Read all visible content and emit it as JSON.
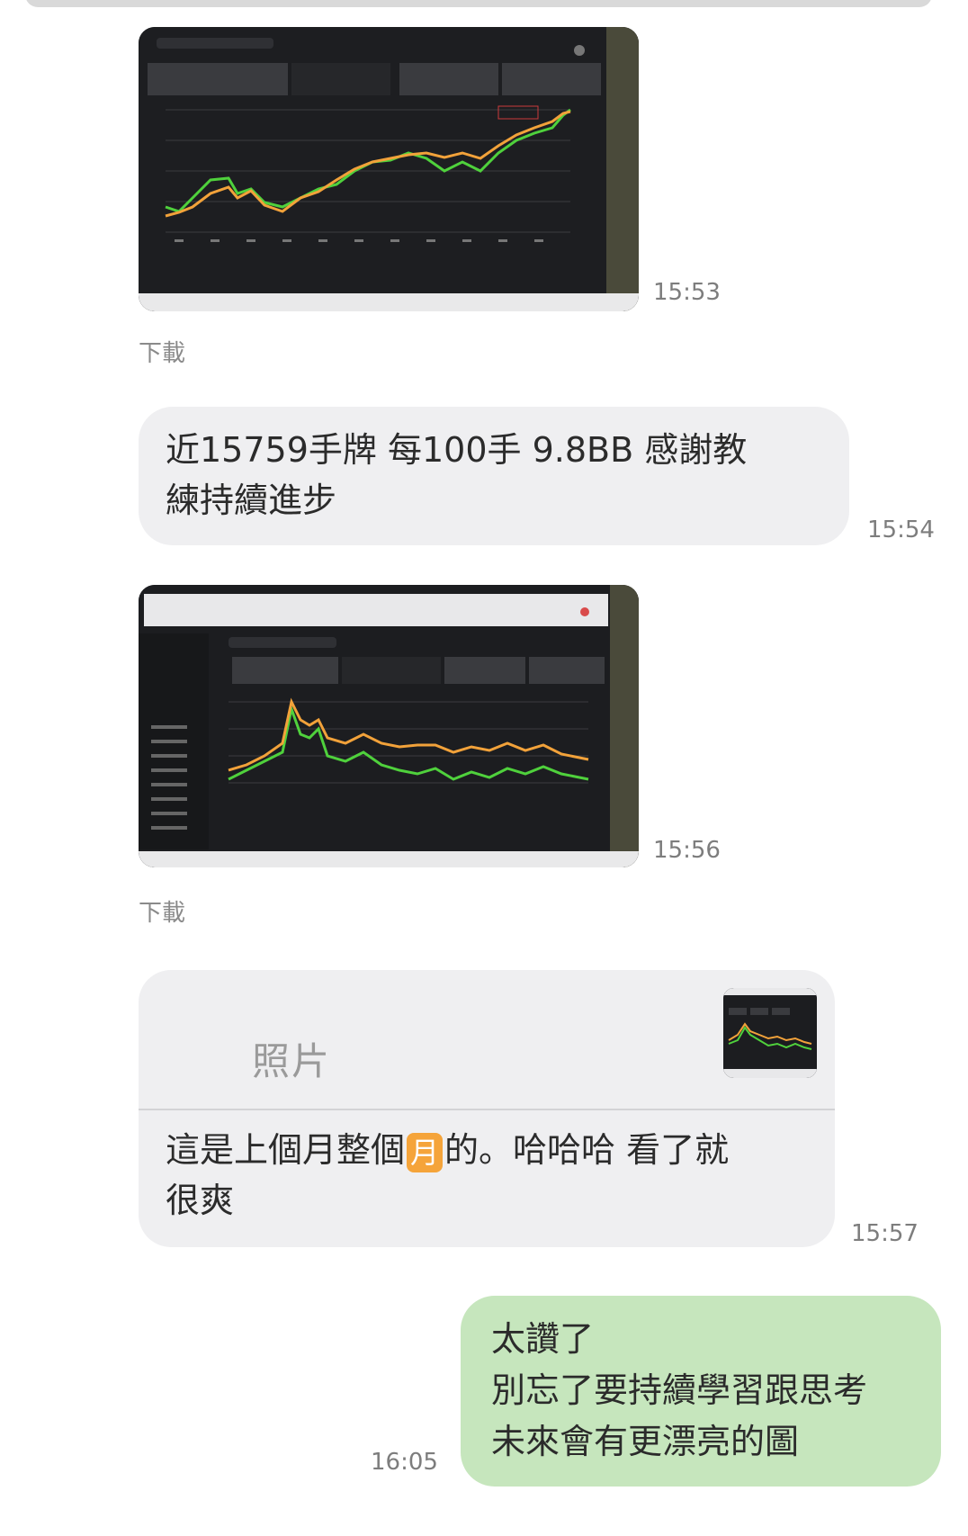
{
  "messages": [
    {
      "type": "image",
      "time": "15:53",
      "download_label": "下載"
    },
    {
      "type": "text",
      "text_line1": "近15759手牌 每100手 9.8BB 感謝教",
      "text_line2": "練持續進步",
      "time": "15:54"
    },
    {
      "type": "image",
      "time": "15:56",
      "download_label": "下載"
    },
    {
      "type": "reply",
      "quoted_label": "照片",
      "text_line1_a": "這是上個月整個",
      "text_line1_emoji": "月",
      "text_line1_b": "的。哈哈哈 看了就",
      "text_line2": "很爽",
      "time": "15:57"
    },
    {
      "type": "own_text",
      "lines": [
        "太讚了",
        "別忘了要持續學習跟思考",
        "未來會有更漂亮的圖"
      ],
      "time": "16:05"
    }
  ],
  "colors": {
    "own_bubble": "#c6e6bd",
    "other_bubble": "#efeff1",
    "timestamp": "#7d7d7d",
    "chart_orange": "#f2a23a",
    "chart_green": "#4fd13c"
  }
}
